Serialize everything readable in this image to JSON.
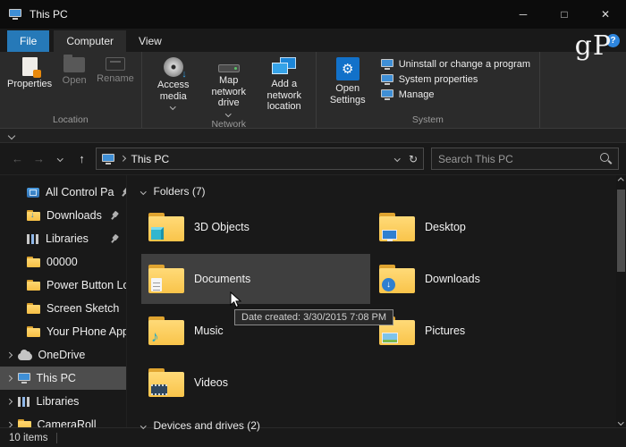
{
  "titlebar": {
    "title": "This PC"
  },
  "icons": {
    "minimize": "─",
    "maximize": "□",
    "close": "✕",
    "back": "←",
    "forward": "→",
    "up": "↑",
    "refresh": "↻",
    "help": "?",
    "gear": "⚙",
    "music_note": "♪",
    "down_arrow": "↓"
  },
  "ribbon": {
    "tabs": {
      "file": "File",
      "computer": "Computer",
      "view": "View"
    },
    "watermark": "gP",
    "location": {
      "name": "Location",
      "properties": "Properties",
      "open": "Open",
      "rename": "Rename"
    },
    "network": {
      "name": "Network",
      "access_media": "Access media",
      "map_drive": "Map network drive",
      "add_location": "Add a network location"
    },
    "system": {
      "name": "System",
      "open_settings": "Open Settings",
      "uninstall": "Uninstall or change a program",
      "sys_props": "System properties",
      "manage": "Manage"
    }
  },
  "navbar": {
    "address": "This PC",
    "search_placeholder": "Search This PC"
  },
  "sidebar": {
    "items": [
      {
        "label": "All Control Pa",
        "pinned": true
      },
      {
        "label": "Downloads",
        "pinned": true
      },
      {
        "label": "Libraries",
        "pinned": true
      },
      {
        "label": "00000"
      },
      {
        "label": "Power Button Lo"
      },
      {
        "label": "Screen Sketch"
      },
      {
        "label": "Your PHone App"
      },
      {
        "label": "OneDrive"
      },
      {
        "label": "This PC",
        "selected": true
      },
      {
        "label": "Libraries"
      },
      {
        "label": "CameraRoll"
      }
    ]
  },
  "content": {
    "folders_header": "Folders (7)",
    "folders": [
      {
        "name": "3D Objects"
      },
      {
        "name": "Desktop"
      },
      {
        "name": "Documents",
        "hover": true
      },
      {
        "name": "Downloads"
      },
      {
        "name": "Music"
      },
      {
        "name": "Pictures"
      },
      {
        "name": "Videos"
      }
    ],
    "devices_header": "Devices and drives (2)",
    "tooltip": "Date created: 3/30/2015 7:08 PM"
  },
  "statusbar": {
    "count": "10 items"
  }
}
